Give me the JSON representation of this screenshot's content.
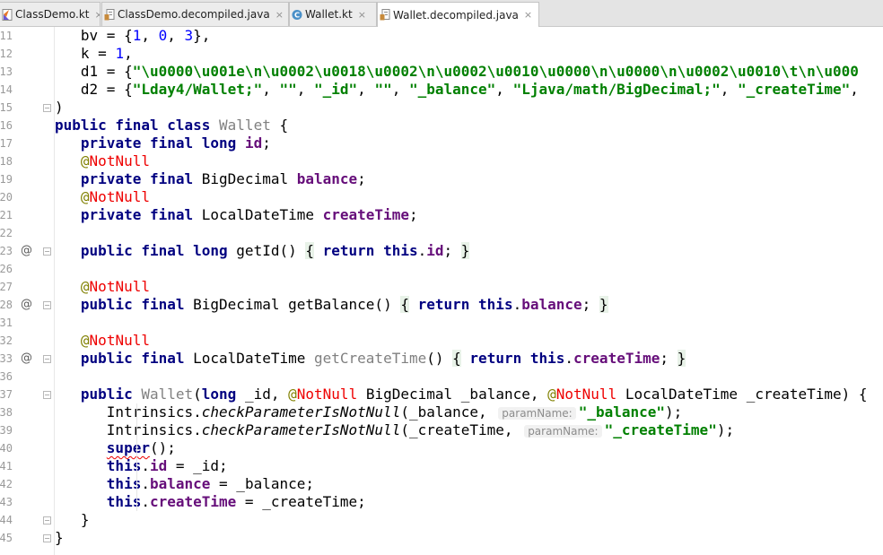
{
  "tabs": [
    {
      "label": "ClassDemo.kt",
      "icon": "kotlin-file-icon",
      "active": false
    },
    {
      "label": "ClassDemo.decompiled.java",
      "icon": "java-decompiled-file-icon",
      "active": false
    },
    {
      "label": "Wallet.kt",
      "icon": "kotlin-class-file-icon",
      "active": false
    },
    {
      "label": "Wallet.decompiled.java",
      "icon": "java-decompiled-file-icon",
      "active": true
    }
  ],
  "tab_close_glyph": "×",
  "line_numbers": [
    "11",
    "12",
    "13",
    "14",
    "15",
    "16",
    "17",
    "18",
    "19",
    "20",
    "21",
    "22",
    "23",
    "26",
    "27",
    "28",
    "31",
    "32",
    "33",
    "36",
    "37",
    "38",
    "39",
    "40",
    "41",
    "42",
    "43",
    "44",
    "45"
  ],
  "gutter_marker": "@",
  "fold_glyph": "−",
  "hint_label": "paramName:",
  "colors": {
    "keyword": "#000080",
    "field": "#660e7a",
    "string": "#008000",
    "number": "#0000ff",
    "not_null": "#ee0000",
    "annotation_at": "#808000",
    "unused": "#808080"
  },
  "code": [
    {
      "ln": "11",
      "segs": [
        [
          "",
          "   bv = {"
        ],
        [
          "num",
          "1"
        ],
        [
          "",
          ", "
        ],
        [
          "num",
          "0"
        ],
        [
          "",
          ", "
        ],
        [
          "num",
          "3"
        ],
        [
          "",
          "},"
        ]
      ]
    },
    {
      "ln": "12",
      "segs": [
        [
          "",
          "   k = "
        ],
        [
          "num",
          "1"
        ],
        [
          "",
          ","
        ]
      ]
    },
    {
      "ln": "13",
      "segs": [
        [
          "",
          "   d1 = {"
        ],
        [
          "str",
          "\"\\u0000\\u001e\\n\\u0002\\u0018\\u0002\\n\\u0002\\u0010\\u0000\\n\\u0000\\n\\u0002\\u0010\\t\\n\\u000"
        ]
      ]
    },
    {
      "ln": "14",
      "segs": [
        [
          "",
          "   d2 = {"
        ],
        [
          "str",
          "\"Lday4/Wallet;\""
        ],
        [
          "",
          ", "
        ],
        [
          "str",
          "\"\""
        ],
        [
          "",
          ", "
        ],
        [
          "str",
          "\"_id\""
        ],
        [
          "",
          ", "
        ],
        [
          "str",
          "\"\""
        ],
        [
          "",
          ", "
        ],
        [
          "str",
          "\"_balance\""
        ],
        [
          "",
          ", "
        ],
        [
          "str",
          "\"Ljava/math/BigDecimal;\""
        ],
        [
          "",
          ", "
        ],
        [
          "str",
          "\"_createTime\""
        ],
        [
          "",
          ","
        ]
      ]
    },
    {
      "ln": "15",
      "segs": [
        [
          "",
          ")"
        ]
      ]
    },
    {
      "ln": "16",
      "segs": [
        [
          "kw",
          "public final class "
        ],
        [
          "gray",
          "Wallet"
        ],
        [
          "",
          " {"
        ]
      ]
    },
    {
      "ln": "17",
      "segs": [
        [
          "",
          "   "
        ],
        [
          "kw",
          "private final long "
        ],
        [
          "fld",
          "id"
        ],
        [
          "",
          ";"
        ]
      ]
    },
    {
      "ln": "18",
      "segs": [
        [
          "",
          "   "
        ],
        [
          "ann",
          "@"
        ],
        [
          "nn",
          "NotNull"
        ]
      ]
    },
    {
      "ln": "19",
      "segs": [
        [
          "",
          "   "
        ],
        [
          "kw",
          "private final "
        ],
        [
          "",
          "BigDecimal "
        ],
        [
          "fld",
          "balance"
        ],
        [
          "",
          ";"
        ]
      ]
    },
    {
      "ln": "20",
      "segs": [
        [
          "",
          "   "
        ],
        [
          "ann",
          "@"
        ],
        [
          "nn",
          "NotNull"
        ]
      ]
    },
    {
      "ln": "21",
      "segs": [
        [
          "",
          "   "
        ],
        [
          "kw",
          "private final "
        ],
        [
          "",
          "LocalDateTime "
        ],
        [
          "fld",
          "createTime"
        ],
        [
          "",
          ";"
        ]
      ]
    },
    {
      "ln": "22",
      "segs": []
    },
    {
      "ln": "23",
      "segs": [
        [
          "",
          "   "
        ],
        [
          "kw",
          "public final long "
        ],
        [
          "",
          "getId() "
        ],
        [
          "brace",
          "{"
        ],
        [
          "",
          " "
        ],
        [
          "kw",
          "return this"
        ],
        [
          "",
          "."
        ],
        [
          "fld",
          "id"
        ],
        [
          "",
          "; "
        ],
        [
          "brace",
          "}"
        ]
      ]
    },
    {
      "ln": "26",
      "segs": []
    },
    {
      "ln": "27",
      "segs": [
        [
          "",
          "   "
        ],
        [
          "ann",
          "@"
        ],
        [
          "nn",
          "NotNull"
        ]
      ]
    },
    {
      "ln": "28",
      "segs": [
        [
          "",
          "   "
        ],
        [
          "kw",
          "public final "
        ],
        [
          "",
          "BigDecimal getBalance() "
        ],
        [
          "brace",
          "{"
        ],
        [
          "",
          " "
        ],
        [
          "kw",
          "return this"
        ],
        [
          "",
          "."
        ],
        [
          "fld",
          "balance"
        ],
        [
          "",
          "; "
        ],
        [
          "brace",
          "}"
        ]
      ]
    },
    {
      "ln": "31",
      "segs": []
    },
    {
      "ln": "32",
      "segs": [
        [
          "",
          "   "
        ],
        [
          "ann",
          "@"
        ],
        [
          "nn",
          "NotNull"
        ]
      ]
    },
    {
      "ln": "33",
      "segs": [
        [
          "",
          "   "
        ],
        [
          "kw",
          "public final "
        ],
        [
          "",
          "LocalDateTime "
        ],
        [
          "gray",
          "getCreateTime"
        ],
        [
          "",
          "() "
        ],
        [
          "brace",
          "{"
        ],
        [
          "",
          " "
        ],
        [
          "kw",
          "return this"
        ],
        [
          "",
          "."
        ],
        [
          "fld",
          "createTime"
        ],
        [
          "",
          "; "
        ],
        [
          "brace",
          "}"
        ]
      ]
    },
    {
      "ln": "36",
      "segs": []
    },
    {
      "ln": "37",
      "segs": [
        [
          "",
          "   "
        ],
        [
          "kw",
          "public "
        ],
        [
          "gray",
          "Wallet"
        ],
        [
          "",
          "("
        ],
        [
          "kw",
          "long "
        ],
        [
          "",
          "_id, "
        ],
        [
          "ann",
          "@"
        ],
        [
          "nn",
          "NotNull"
        ],
        [
          "",
          " BigDecimal _balance, "
        ],
        [
          "ann",
          "@"
        ],
        [
          "nn",
          "NotNull"
        ],
        [
          "",
          " LocalDateTime _createTime) {"
        ]
      ]
    },
    {
      "ln": "38",
      "segs": [
        [
          "",
          "      Intrinsics."
        ],
        [
          "it",
          "checkParameterIsNotNull"
        ],
        [
          "",
          "(_balance, "
        ],
        [
          "hint",
          "paramName:"
        ],
        [
          "str",
          "\"_balance\""
        ],
        [
          "",
          ");"
        ]
      ]
    },
    {
      "ln": "39",
      "segs": [
        [
          "",
          "      Intrinsics."
        ],
        [
          "it",
          "checkParameterIsNotNull"
        ],
        [
          "",
          "(_createTime, "
        ],
        [
          "hint",
          "paramName:"
        ],
        [
          "str",
          "\"_createTime\""
        ],
        [
          "",
          ");"
        ]
      ]
    },
    {
      "ln": "40",
      "segs": [
        [
          "",
          "      "
        ],
        [
          "kwsq",
          "super"
        ],
        [
          "",
          "();"
        ]
      ]
    },
    {
      "ln": "41",
      "segs": [
        [
          "",
          "      "
        ],
        [
          "kw",
          "this"
        ],
        [
          "",
          "."
        ],
        [
          "fld",
          "id"
        ],
        [
          "",
          " = _id;"
        ]
      ]
    },
    {
      "ln": "42",
      "segs": [
        [
          "",
          "      "
        ],
        [
          "kw",
          "this"
        ],
        [
          "",
          "."
        ],
        [
          "fld",
          "balance"
        ],
        [
          "",
          " = _balance;"
        ]
      ]
    },
    {
      "ln": "43",
      "segs": [
        [
          "",
          "      "
        ],
        [
          "kw",
          "this"
        ],
        [
          "",
          "."
        ],
        [
          "fld",
          "createTime"
        ],
        [
          "",
          " = _createTime;"
        ]
      ]
    },
    {
      "ln": "44",
      "segs": [
        [
          "",
          "   }"
        ]
      ]
    },
    {
      "ln": "45",
      "segs": [
        [
          "",
          "}"
        ]
      ]
    }
  ]
}
